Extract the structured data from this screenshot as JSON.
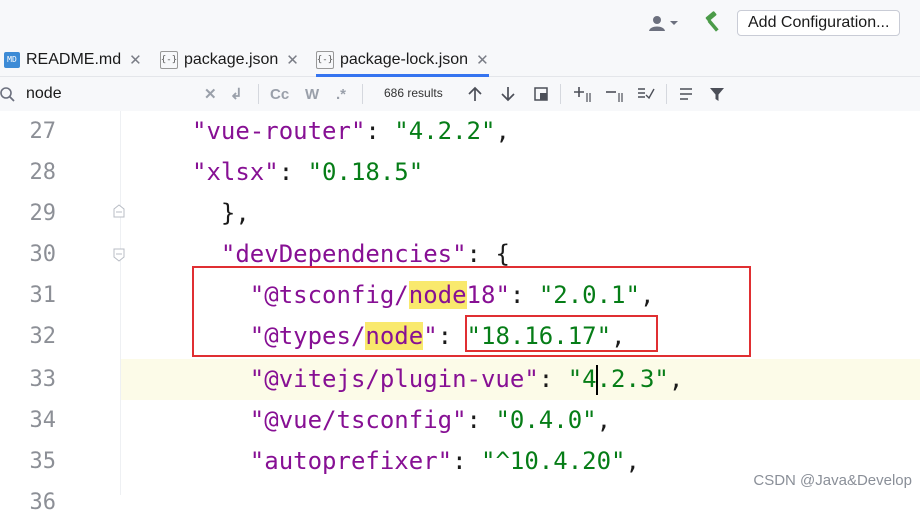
{
  "toolbar": {
    "user_icon": "user-icon",
    "build_icon": "hammer-icon",
    "add_configuration_label": "Add Configuration..."
  },
  "tabs": [
    {
      "label": "README.md",
      "icon": "markdown-file-icon",
      "badge": "MD"
    },
    {
      "label": "package.json",
      "icon": "json-file-icon",
      "badge": "{-}"
    },
    {
      "label": "package-lock.json",
      "icon": "json-file-icon",
      "badge": "{-}",
      "active": true
    }
  ],
  "find": {
    "query": "node",
    "results_text": "686 results",
    "match_case_label": "Cc",
    "words_label": "W",
    "regex_label": ".*"
  },
  "editor": {
    "current_line": 33,
    "lines": [
      {
        "num": "27",
        "indent": "    ",
        "key": "\"vue-router\"",
        "sep": ": ",
        "value": "\"4.2.2\"",
        "tail": ","
      },
      {
        "num": "28",
        "indent": "    ",
        "key": "\"xlsx\"",
        "sep": ": ",
        "value": "\"0.18.5\"",
        "tail": ""
      },
      {
        "num": "29",
        "text": "  },"
      },
      {
        "num": "30",
        "key_text": "  \"devDependencies\"",
        "tail_text": ": {"
      },
      {
        "num": "31",
        "key_pre": "    \"@tsconfig/",
        "key_hit": "node",
        "key_post": "18\"",
        "sep": ": ",
        "value": "\"2.0.1\"",
        "tail": ","
      },
      {
        "num": "32",
        "key_pre": "    \"@types/",
        "key_hit": "node",
        "key_post": "\"",
        "sep": ": ",
        "value": "\"18.16.17\"",
        "tail": ","
      },
      {
        "num": "33",
        "key": "    \"@vitejs/plugin-vue\"",
        "sep": ": ",
        "value_pre": "\"4",
        "value_post": ".2.3\"",
        "tail": ","
      },
      {
        "num": "34",
        "key": "    \"@vue/tsconfig\"",
        "sep": ": ",
        "value": "\"0.4.0\"",
        "tail": ","
      },
      {
        "num": "35",
        "key": "    \"autoprefixer\"",
        "sep": ": ",
        "value": "\"^10.4.20\"",
        "tail": ","
      },
      {
        "num": "36"
      }
    ]
  },
  "watermark": "CSDN @Java&Develop",
  "colors": {
    "key": "#871094",
    "string": "#067d17",
    "highlight": "#f9e96d",
    "annotation": "#e02f32",
    "accent": "#3574f0"
  }
}
